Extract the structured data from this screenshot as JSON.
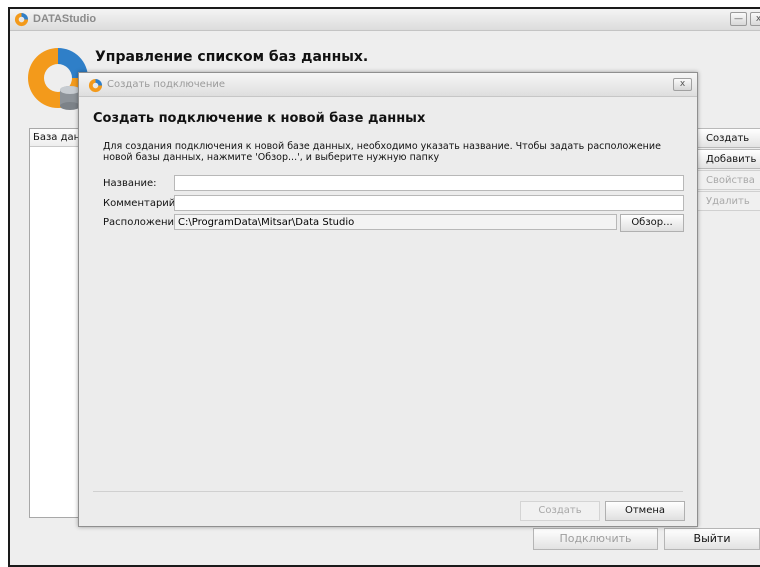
{
  "app": {
    "title": "DATAStudio",
    "minimize_icon": "minimize-icon",
    "main_heading": "Управление списком баз данных."
  },
  "list": {
    "header": "База данн"
  },
  "side_buttons": [
    {
      "label": "Создать",
      "enabled": true
    },
    {
      "label": "Добавить",
      "enabled": true
    },
    {
      "label": "Свойства",
      "enabled": false
    },
    {
      "label": "Удалить",
      "enabled": false
    }
  ],
  "bottom_buttons": {
    "connect": "Подключить",
    "exit": "Выйти"
  },
  "dialog": {
    "title": "Создать подключение",
    "heading": "Создать подключение к новой базе данных",
    "description": "Для создания подключения к новой базе данных, необходимо указать название. Чтобы задать расположение новой базы данных, нажмите 'Обзор...', и выберите нужную папку",
    "fields": {
      "name_label": "Название:",
      "name_value": "",
      "comment_label": "Комментарий:",
      "comment_value": "",
      "location_label": "Расположение:",
      "location_value": "C:\\ProgramData\\Mitsar\\Data Studio"
    },
    "browse_label": "Обзор...",
    "create_label": "Создать",
    "cancel_label": "Отмена"
  },
  "colors": {
    "logo_orange": "#f39a1b",
    "logo_blue": "#2f7fc8"
  }
}
